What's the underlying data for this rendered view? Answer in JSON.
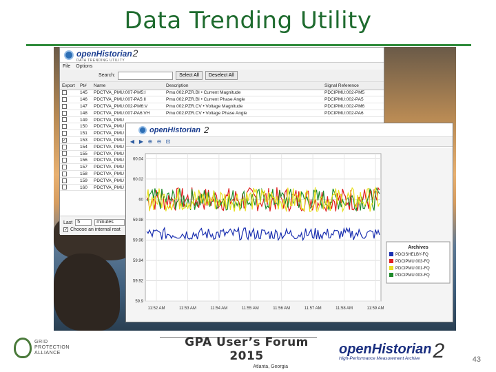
{
  "slide": {
    "title": "Data Trending Utility",
    "page_number": "43",
    "footer_forum": "GPA User’s Forum 2015",
    "footer_location": "Atlanta, Georgia",
    "gpa_lines": [
      "GRID",
      "PROTECTION",
      "ALLIANCE"
    ],
    "oh_logo": "openHistorian",
    "oh_version": "2",
    "oh_tagline": "High-Performance Measurement Archive"
  },
  "app": {
    "logo_text": "openHistorian",
    "logo_version": "2",
    "logo_subtitle": "DATA TRENDING UTILITY",
    "menu": [
      "File",
      "Options"
    ],
    "search_label": "Search:",
    "search_value": "",
    "select_all": "Select All",
    "deselect_all": "Deselect All",
    "columns": [
      "Export",
      "Pt#",
      "Name",
      "Description",
      "Signal Reference"
    ],
    "rows": [
      {
        "checked": false,
        "pt": "145",
        "name": "PDCTVA_PMU:007-PM5:I",
        "desc": "Pmu.002.PZR.BI  • Current Magnitude",
        "ref": "PDCIPMU:002-PM5"
      },
      {
        "checked": false,
        "pt": "146",
        "name": "PDCTVA_PMU:007-PA5:II",
        "desc": "Pmu.002.PZR.BI  • Current Phase Angle",
        "ref": "PDCIPMU:002-PA5"
      },
      {
        "checked": false,
        "pt": "147",
        "name": "PDCTVA_PMU:002-PM6:V",
        "desc": "Pmu.002.PZR.CV  • Voltage Magnitude",
        "ref": "PDCIPMU:002-PM6"
      },
      {
        "checked": false,
        "pt": "148",
        "name": "PDCTVA_PMU:007-PA6:VH",
        "desc": "Pmu.002.PZR.CV  • Voltage Phase Angle",
        "ref": "PDCIPMU:002-PA6"
      },
      {
        "checked": false,
        "pt": "149",
        "name": "PDCTVA_PMU",
        "desc": "",
        "ref": ""
      },
      {
        "checked": false,
        "pt": "150",
        "name": "PDCTVA_PMU",
        "desc": "",
        "ref": ""
      },
      {
        "checked": false,
        "pt": "151",
        "name": "PDCTVA_PMU",
        "desc": "",
        "ref": ""
      },
      {
        "checked": true,
        "pt": "153",
        "name": "PDCTVA_PMU",
        "desc": "",
        "ref": ""
      },
      {
        "checked": false,
        "pt": "154",
        "name": "PDCTVA_PMU",
        "desc": "",
        "ref": ""
      },
      {
        "checked": false,
        "pt": "155",
        "name": "PDCTVA_PMU",
        "desc": "",
        "ref": ""
      },
      {
        "checked": false,
        "pt": "156",
        "name": "PDCTVA_PMU",
        "desc": "",
        "ref": ""
      },
      {
        "checked": false,
        "pt": "157",
        "name": "PDCTVA_PMU",
        "desc": "",
        "ref": ""
      },
      {
        "checked": false,
        "pt": "158",
        "name": "PDCTVA_PMU",
        "desc": "",
        "ref": ""
      },
      {
        "checked": false,
        "pt": "159",
        "name": "PDCTVA_PMU",
        "desc": "",
        "ref": ""
      },
      {
        "checked": false,
        "pt": "160",
        "name": "PDCTVA_PMU",
        "desc": "",
        "ref": ""
      }
    ],
    "last_label": "Last",
    "last_value": "5",
    "unit_value": "minutes",
    "interval_label": "Choose an internal reat"
  },
  "chart_window": {
    "logo_text": "openHistorian",
    "logo_version": "2",
    "toolbar_icons": [
      "arrow-left-icon",
      "arrow-right-icon",
      "zoom-in-icon",
      "zoom-out-icon",
      "zoom-fit-icon"
    ]
  },
  "chart_data": {
    "type": "line",
    "title": "",
    "xlabel": "",
    "ylabel": "",
    "x": [
      "11:52 AM",
      "11:53 AM",
      "11:54 AM",
      "11:55 AM",
      "11:56 AM",
      "11:57 AM",
      "11:58 AM",
      "11:59 AM"
    ],
    "yticks": [
      "60.04",
      "60.02",
      "60",
      "59.98",
      "59.96",
      "59.94",
      "59.92",
      "59.9"
    ],
    "ylim": [
      59.9,
      60.045
    ],
    "grid": true,
    "legend_title": "Archives",
    "legend_position": "right",
    "series": [
      {
        "name": "PDCISHELBY-FQ",
        "color": "#1a2fb0",
        "mean": 59.966,
        "amplitude": 0.006
      },
      {
        "name": "PDCIPMU:003-FQ",
        "color": "#e02020",
        "mean": 60.0,
        "amplitude": 0.012
      },
      {
        "name": "PDCIPMU:001-FQ",
        "color": "#e8e020",
        "mean": 60.0,
        "amplitude": 0.012
      },
      {
        "name": "PDCIPMU:003-FQ",
        "color": "#1f8a2a",
        "mean": 60.0,
        "amplitude": 0.011
      }
    ]
  }
}
